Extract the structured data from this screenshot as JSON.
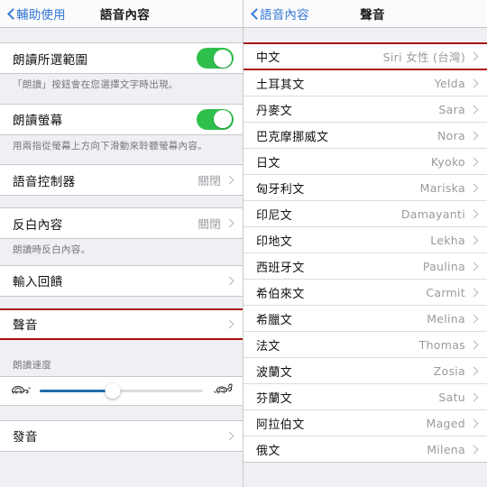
{
  "left_panel": {
    "navbar": {
      "back_label": "輔助使用",
      "title": "語音內容",
      "back_icon": "chevron-left-icon"
    },
    "speak_selection": {
      "label": "朗讀所選範圍",
      "toggle_state": "on",
      "note": "「朗讀」按鈕會在您選擇文字時出現。"
    },
    "speak_screen": {
      "label": "朗讀螢幕",
      "toggle_state": "on",
      "note": "用兩指從螢幕上方向下滑動來聆聽螢幕內容。"
    },
    "speech_controller": {
      "label": "語音控制器",
      "value": "關閉"
    },
    "highlight_content": {
      "label": "反白內容",
      "value": "關閉",
      "note": "朗讀時反白內容。"
    },
    "typing_feedback": {
      "label": "輸入回饋"
    },
    "voices": {
      "label": "聲音",
      "highlighted": true
    },
    "speaking_rate": {
      "header": "朗讀速度",
      "value_percent": 45,
      "slow_icon": "tortoise-icon",
      "fast_icon": "hare-icon"
    },
    "pronunciations": {
      "label": "發音"
    }
  },
  "right_panel": {
    "navbar": {
      "back_label": "語音內容",
      "title": "聲音",
      "back_icon": "chevron-left-icon"
    },
    "voice_rows": [
      {
        "label": "中文",
        "value": "Siri 女性 (台灣)",
        "highlighted": true
      },
      {
        "label": "土耳其文",
        "value": "Yelda"
      },
      {
        "label": "丹麥文",
        "value": "Sara"
      },
      {
        "label": "巴克摩挪威文",
        "value": "Nora"
      },
      {
        "label": "日文",
        "value": "Kyoko"
      },
      {
        "label": "匈牙利文",
        "value": "Mariska"
      },
      {
        "label": "印尼文",
        "value": "Damayanti"
      },
      {
        "label": "印地文",
        "value": "Lekha"
      },
      {
        "label": "西班牙文",
        "value": "Paulina"
      },
      {
        "label": "希伯來文",
        "value": "Carmit"
      },
      {
        "label": "希臘文",
        "value": "Melina"
      },
      {
        "label": "法文",
        "value": "Thomas"
      },
      {
        "label": "波蘭文",
        "value": "Zosia"
      },
      {
        "label": "芬蘭文",
        "value": "Satu"
      },
      {
        "label": "阿拉伯文",
        "value": "Maged"
      },
      {
        "label": "俄文",
        "value": "Milena"
      }
    ]
  },
  "colors": {
    "toggle_on": "#2fc04c",
    "tint_blue": "#3478d6",
    "slider_fill": "#1f6cae",
    "highlight_red": "#aa1111",
    "group_bg": "#ffffff",
    "panel_bg": "#eff0f3"
  }
}
